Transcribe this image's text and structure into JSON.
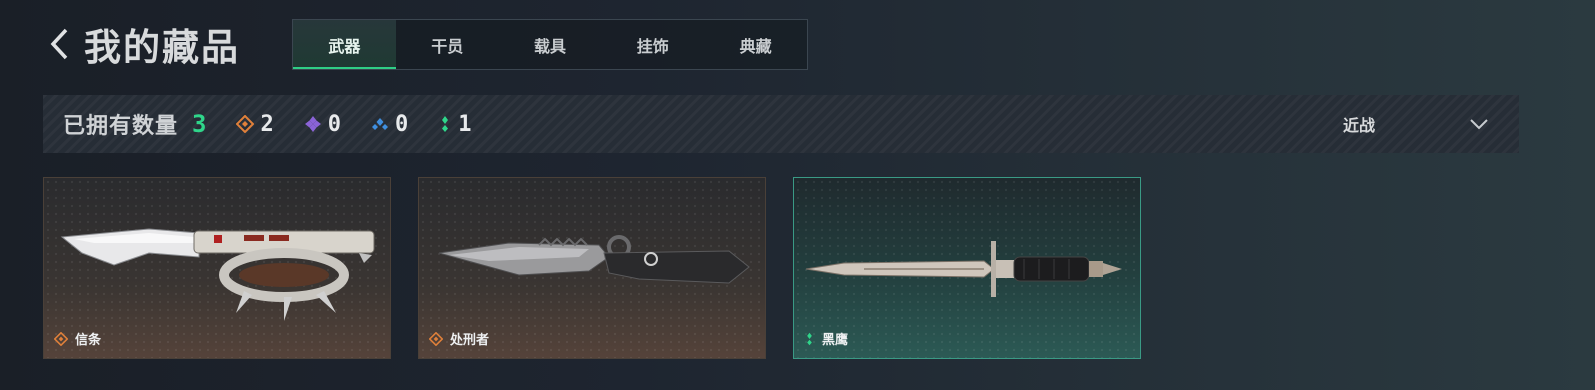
{
  "header": {
    "title": "我的藏品"
  },
  "tabs": [
    {
      "label": "武器",
      "active": true
    },
    {
      "label": "干员",
      "active": false
    },
    {
      "label": "载具",
      "active": false
    },
    {
      "label": "挂饰",
      "active": false
    },
    {
      "label": "典藏",
      "active": false
    }
  ],
  "stats": {
    "label": "已拥有数量",
    "total": "3",
    "rarities": [
      {
        "icon": "orange-diamond-icon",
        "count": "2",
        "color": "#e0803a"
      },
      {
        "icon": "purple-diamond-icon",
        "count": "0",
        "color": "#8a63d6"
      },
      {
        "icon": "blue-diamond-icon",
        "count": "0",
        "color": "#3f8fe0"
      },
      {
        "icon": "green-diamond-icon",
        "count": "1",
        "color": "#2fd58a"
      }
    ]
  },
  "filter": {
    "label": "近战",
    "icon": "chevron-down-icon"
  },
  "items": [
    {
      "name": "信条",
      "rarity_color": "#e0803a",
      "weapon": "knuckle-knife"
    },
    {
      "name": "处刑者",
      "rarity_color": "#e0803a",
      "weapon": "serrated-knife"
    },
    {
      "name": "黑鹰",
      "rarity_color": "#2fd58a",
      "weapon": "dagger"
    }
  ],
  "colors": {
    "accent": "#2fd58a",
    "background": "#1e2530"
  }
}
